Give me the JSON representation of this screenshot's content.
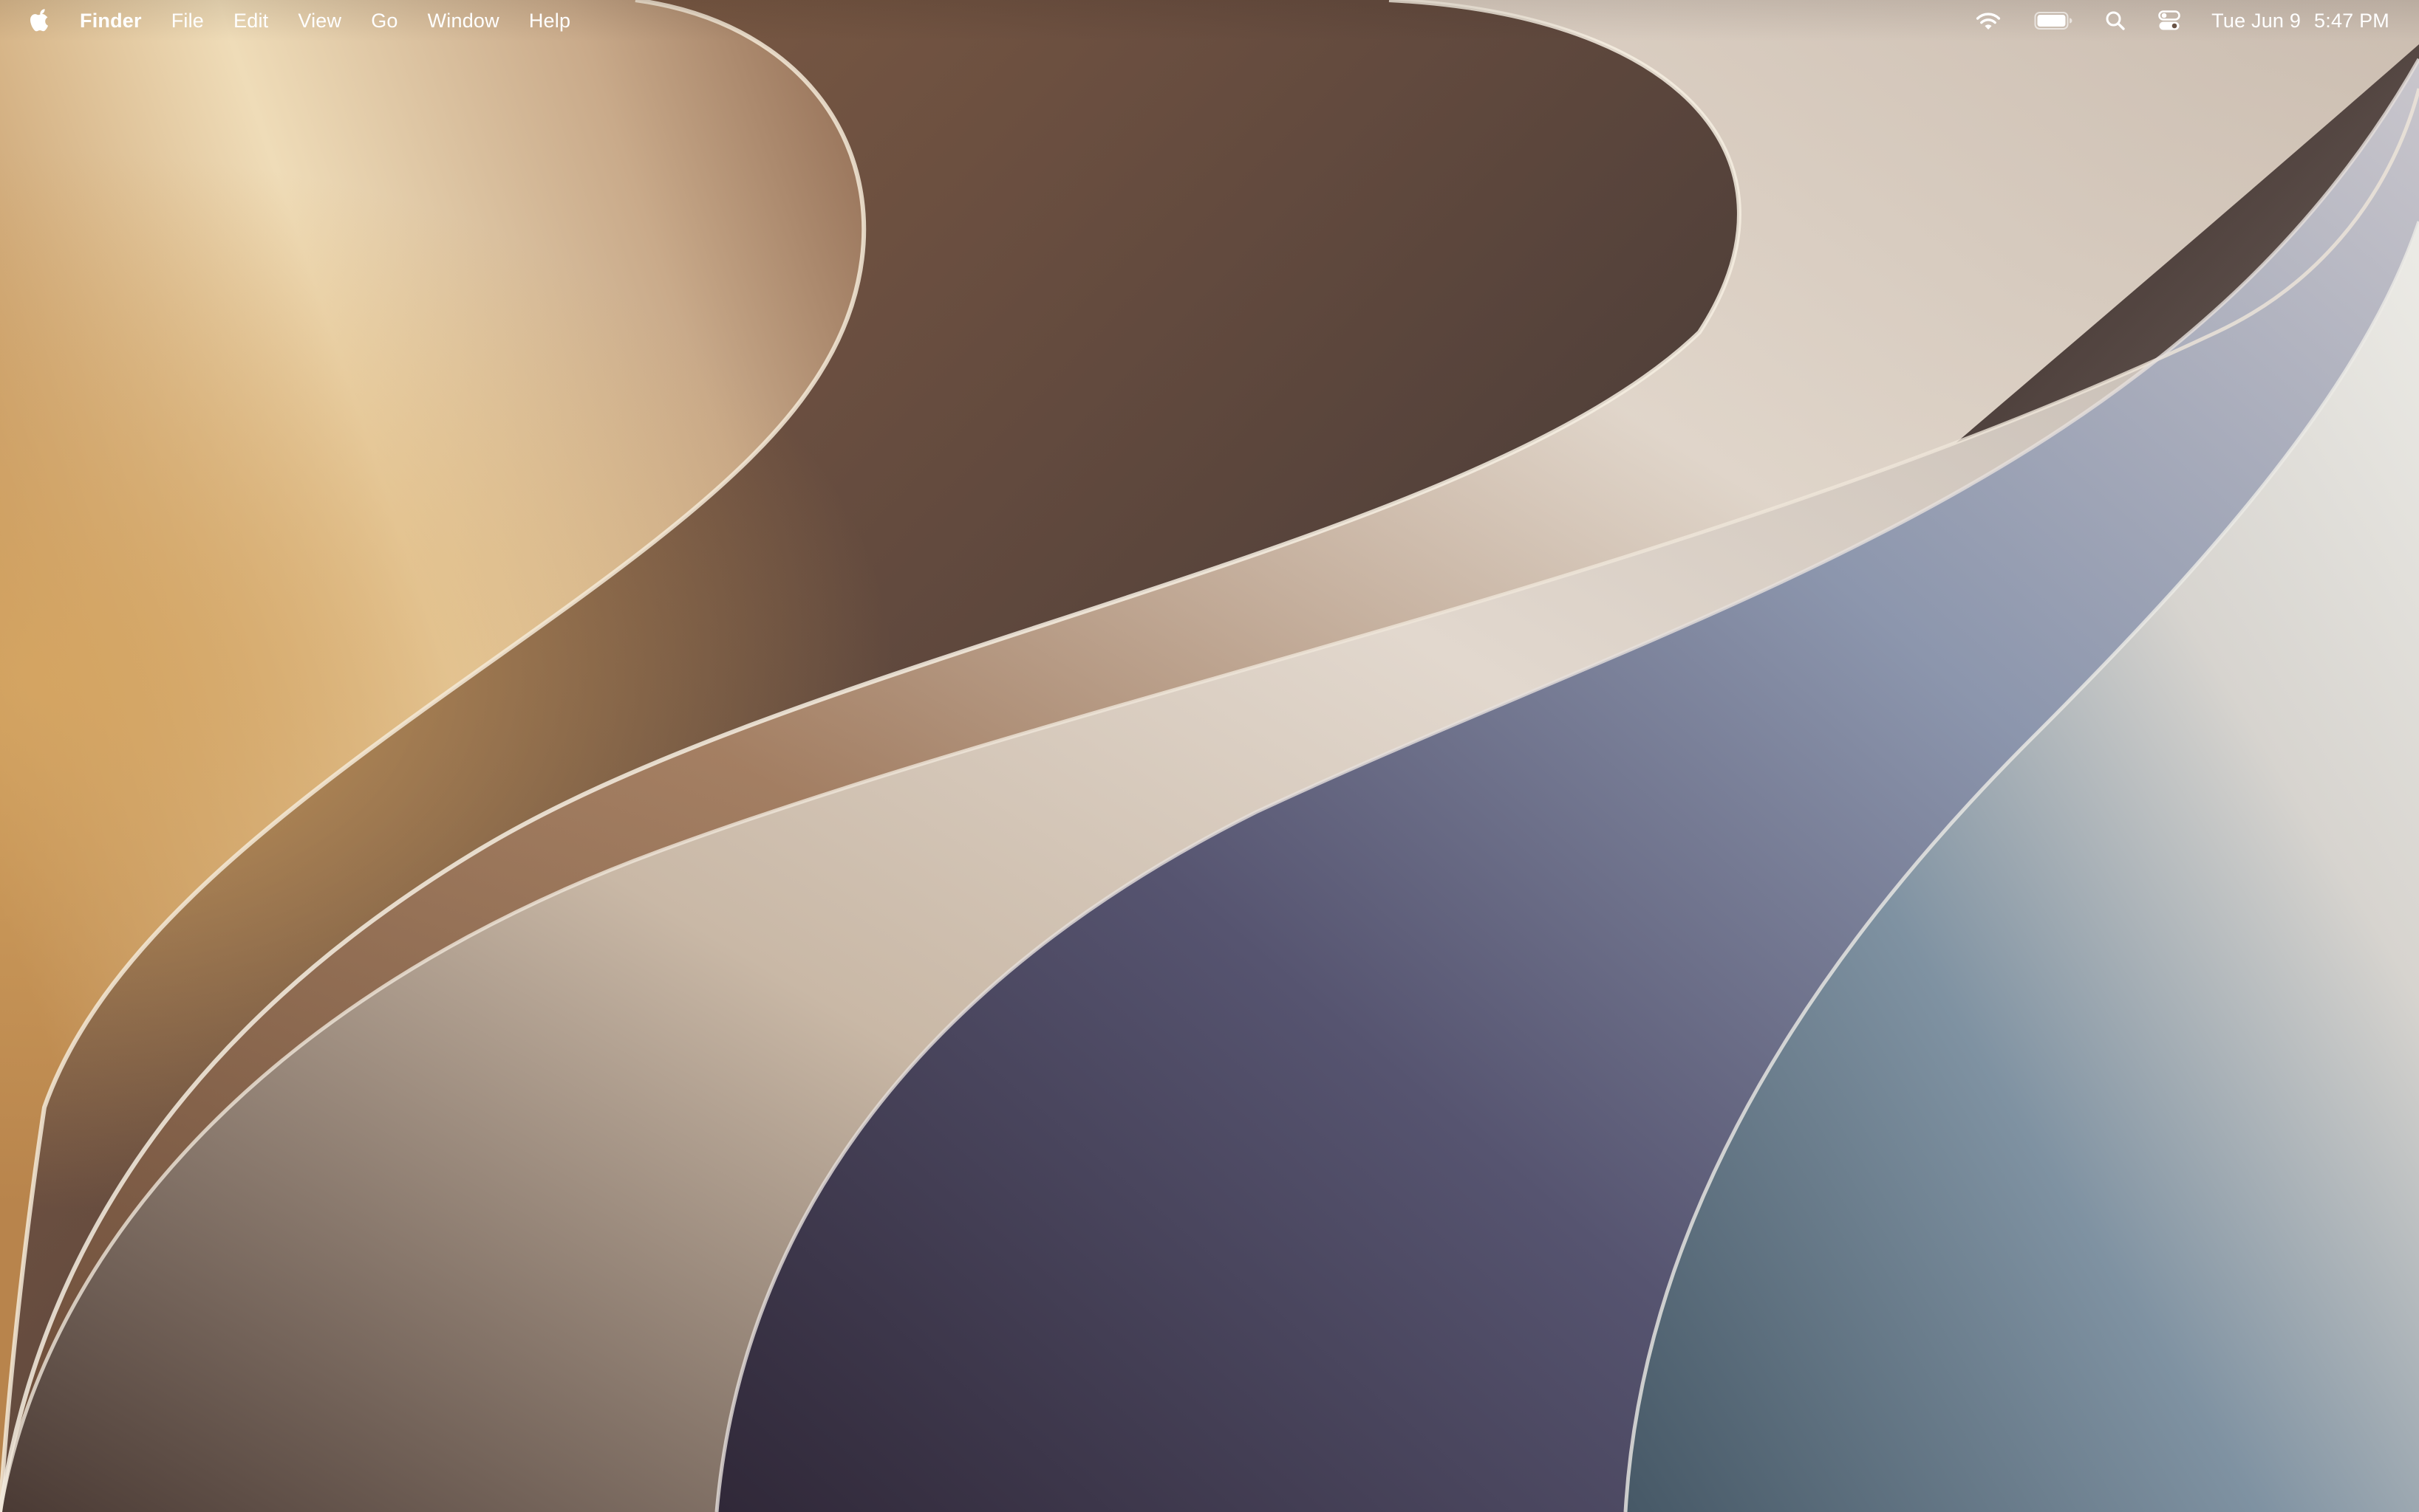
{
  "menubar": {
    "apple_icon": "apple-logo-icon",
    "app_name": "Finder",
    "menus": [
      "File",
      "Edit",
      "View",
      "Go",
      "Window",
      "Help"
    ],
    "status_icons": [
      "wifi-icon",
      "battery-icon",
      "search-icon",
      "control-center-icon"
    ],
    "clock": {
      "date": "Tue Jun 9",
      "time": "5:47 PM"
    }
  },
  "colors": {
    "menubar_text": "#ffffff",
    "wallpaper_gold": "#c8a06a",
    "wallpaper_brown": "#6a4c3c",
    "wallpaper_cream": "#efe6da",
    "wallpaper_slate": "#4e5266",
    "wallpaper_blue_gray": "#6e8092"
  }
}
